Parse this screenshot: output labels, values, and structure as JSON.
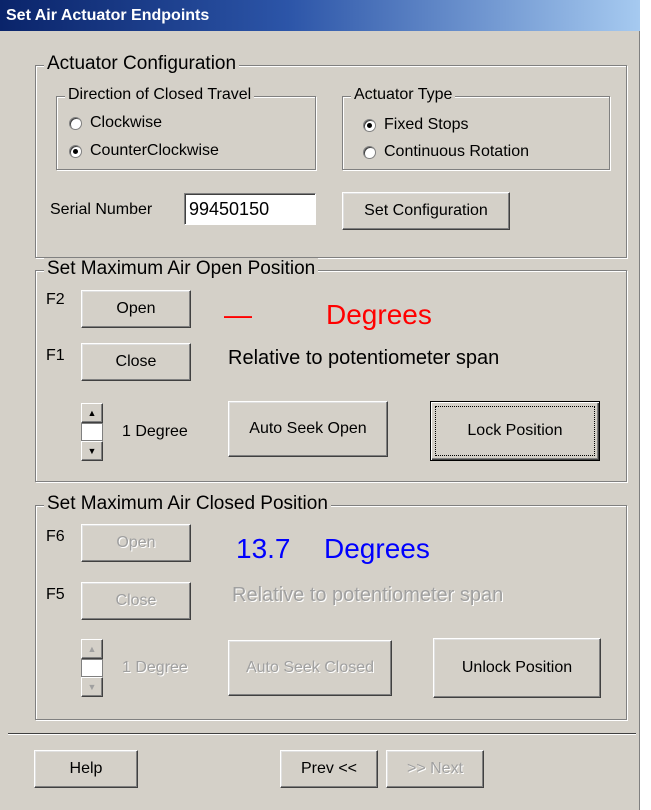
{
  "window": {
    "title": "Set Air Actuator Endpoints"
  },
  "config": {
    "legend": "Actuator Configuration",
    "direction": {
      "legend": "Direction of Closed Travel",
      "options": [
        {
          "label": "Clockwise",
          "checked": false
        },
        {
          "label": "CounterClockwise",
          "checked": true
        }
      ]
    },
    "type": {
      "legend": "Actuator Type",
      "options": [
        {
          "label": "Fixed Stops",
          "checked": true
        },
        {
          "label": "Continuous Rotation",
          "checked": false
        }
      ]
    },
    "serial_label": "Serial Number",
    "serial_value": "99450150",
    "set_button": "Set Configuration"
  },
  "open_section": {
    "legend": "Set Maximum Air Open Position",
    "key_open": "F2",
    "key_close": "F1",
    "open_button": "Open",
    "close_button": "Close",
    "value": "—",
    "units": "Degrees",
    "relative_text": "Relative to potentiometer span",
    "step_label": "1 Degree",
    "auto_seek_button": "Auto Seek Open",
    "lock_button": "Lock Position",
    "value_color": "#ff0000"
  },
  "closed_section": {
    "legend": "Set Maximum Air Closed Position",
    "key_open": "F6",
    "key_close": "F5",
    "open_button": "Open",
    "close_button": "Close",
    "value": "13.7",
    "units": "Degrees",
    "relative_text": "Relative to potentiometer span",
    "step_label": "1 Degree",
    "auto_seek_button": "Auto Seek Closed",
    "unlock_button": "Unlock Position",
    "value_color": "#0000ff"
  },
  "footer": {
    "help_button": "Help",
    "prev_button": "Prev <<",
    "next_button": ">> Next"
  }
}
